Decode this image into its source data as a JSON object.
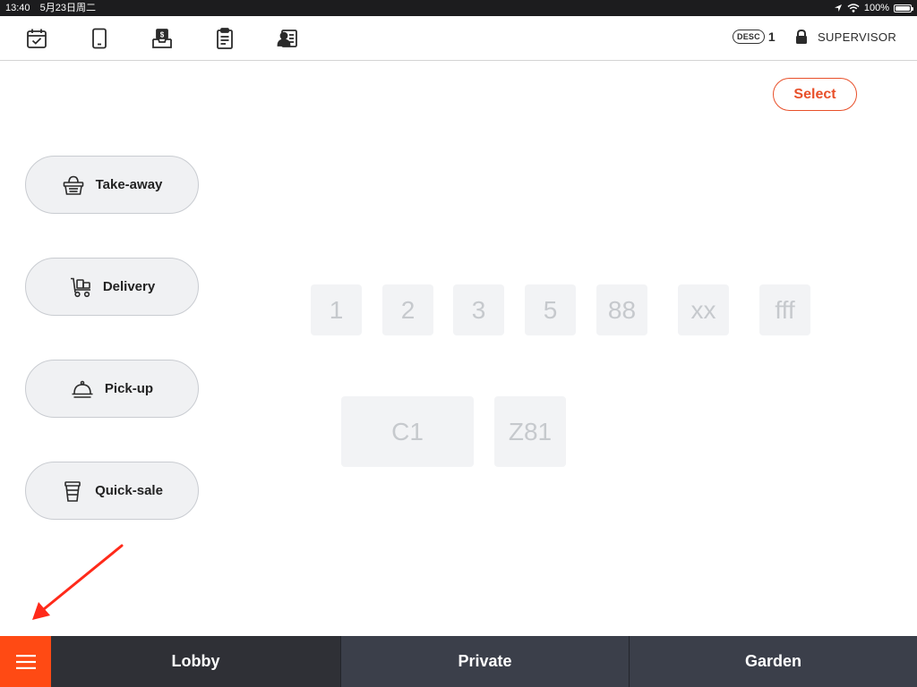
{
  "status_bar": {
    "time": "13:40",
    "date": "5月23日周二",
    "battery": "100%",
    "battery_level": 1.0
  },
  "toolbar": {
    "icons": [
      "calendar-check-icon",
      "tablet-icon",
      "cash-drawer-icon",
      "clipboard-icon",
      "customer-card-icon"
    ],
    "desc_label": "DESC",
    "desc_count": "1",
    "user_label": "SUPERVISOR"
  },
  "select_button": {
    "label": "Select"
  },
  "order_types": [
    {
      "label": "Take-away",
      "icon": "basket-icon"
    },
    {
      "label": "Delivery",
      "icon": "delivery-cart-icon"
    },
    {
      "label": "Pick-up",
      "icon": "cloche-icon"
    },
    {
      "label": "Quick-sale",
      "icon": "cup-icon"
    }
  ],
  "tables": [
    "1",
    "2",
    "3",
    "5",
    "88",
    "xx",
    "fff",
    "C1",
    "Z81"
  ],
  "bottom_nav": {
    "zones": [
      "Lobby",
      "Private",
      "Garden"
    ],
    "active": "Lobby"
  },
  "colors": {
    "accent": "#ff4a14",
    "select": "#e8502a",
    "nav_active": "#2f3036",
    "nav_inactive": "#3b3f4a",
    "annotation_arrow": "#ff2a1a"
  }
}
